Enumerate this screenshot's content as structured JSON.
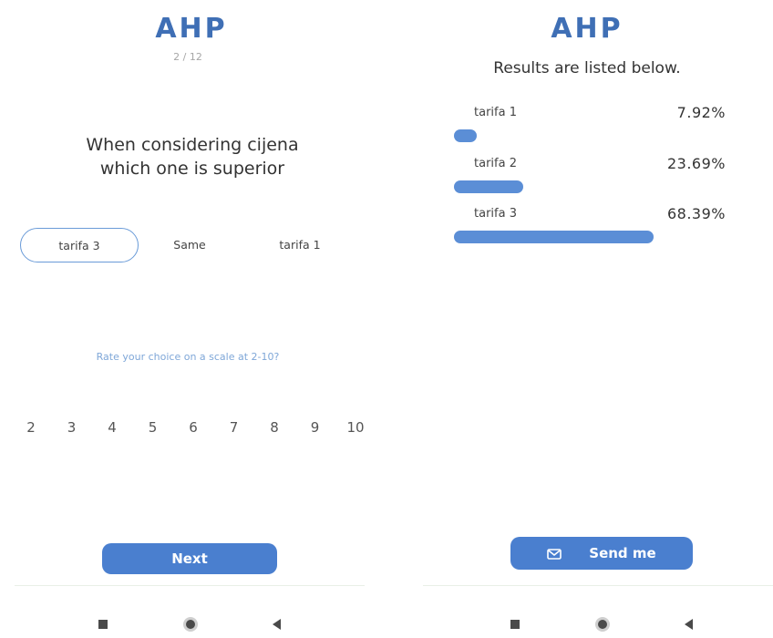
{
  "question_screen": {
    "logo": "AHP",
    "progress": "2 / 12",
    "question_line1": "When considering cijena",
    "question_line2": "which one is superior",
    "choices": {
      "left": "tarifa 3",
      "middle": "Same",
      "right": "tarifa 1"
    },
    "selected_choice": "tarifa 3",
    "rate_prompt": "Rate your choice on a scale at 2-10?",
    "scale": [
      "2",
      "3",
      "4",
      "5",
      "6",
      "7",
      "8",
      "9",
      "10"
    ],
    "next_label": "Next"
  },
  "results_screen": {
    "logo": "AHP",
    "heading": "Results are listed below.",
    "results": [
      {
        "name": "tarifa 1",
        "value": "7.92%",
        "share": 0.0792
      },
      {
        "name": "tarifa 2",
        "value": "23.69%",
        "share": 0.2369
      },
      {
        "name": "tarifa 3",
        "value": "68.39%",
        "share": 0.6839
      }
    ],
    "send_label": "Send me",
    "send_icon": "mail-icon"
  },
  "navigation": {
    "icons": [
      "recent-apps-icon",
      "home-icon",
      "back-icon"
    ]
  },
  "colors": {
    "accent": "#4a7fcf",
    "logo": "#3f6fb5",
    "bar": "#5b8ed6",
    "selected_border": "#6a9bd8",
    "prompt": "#7fa7d8"
  }
}
